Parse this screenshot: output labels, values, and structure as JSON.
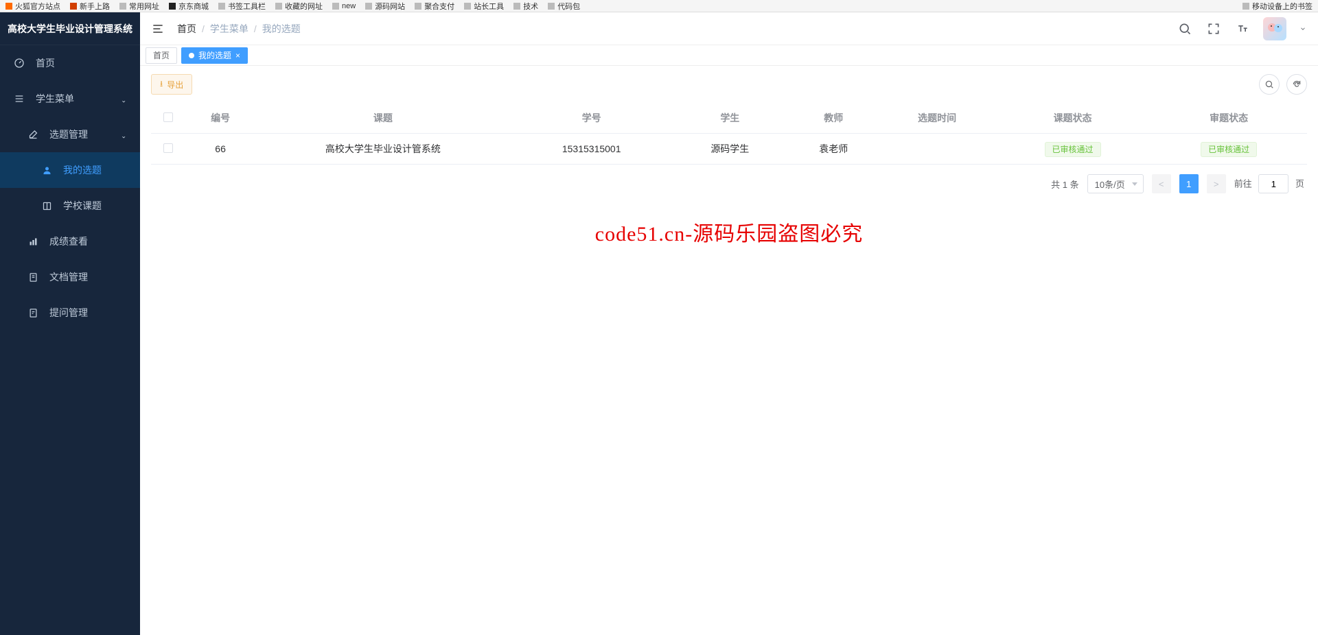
{
  "bookmarkBar": {
    "items": [
      "火狐官方站点",
      "新手上路",
      "常用网址",
      "京东商城",
      "书签工具栏",
      "收藏的网址",
      "new",
      "源码网站",
      "聚合支付",
      "站长工具",
      "技术",
      "代码包"
    ],
    "right": "移动设备上的书签"
  },
  "app": {
    "title": "高校大学生毕业设计管理系统"
  },
  "sidebar": {
    "home": "首页",
    "studentMenu": "学生菜单",
    "topicMgmt": "选题管理",
    "myTopic": "我的选题",
    "schoolTopic": "学校课题",
    "scoreView": "成绩查看",
    "docMgmt": "文档管理",
    "questionMgmt": "提问管理"
  },
  "breadcrumb": {
    "home": "首页",
    "studentMenu": "学生菜单",
    "myTopic": "我的选题"
  },
  "tabs": {
    "home": "首页",
    "myTopic": "我的选题"
  },
  "toolbar": {
    "export": "导出"
  },
  "table": {
    "headers": {
      "id": "编号",
      "topic": "课题",
      "studentNo": "学号",
      "student": "学生",
      "teacher": "教师",
      "selectTime": "选题时间",
      "topicStatus": "课题状态",
      "reviewStatus": "审题状态"
    },
    "rows": [
      {
        "id": "66",
        "topic": "高校大学生毕业设计管系统",
        "studentNo": "15315315001",
        "student": "源码学生",
        "teacher": "袁老师",
        "selectTime": "",
        "topicStatus": "已审核通过",
        "reviewStatus": "已审核通过"
      }
    ]
  },
  "pagination": {
    "total": "共 1 条",
    "pageSize": "10条/页",
    "goToPrefix": "前往",
    "goToSuffix": "页",
    "current": "1"
  },
  "watermark": "code51.cn-源码乐园盗图必究"
}
